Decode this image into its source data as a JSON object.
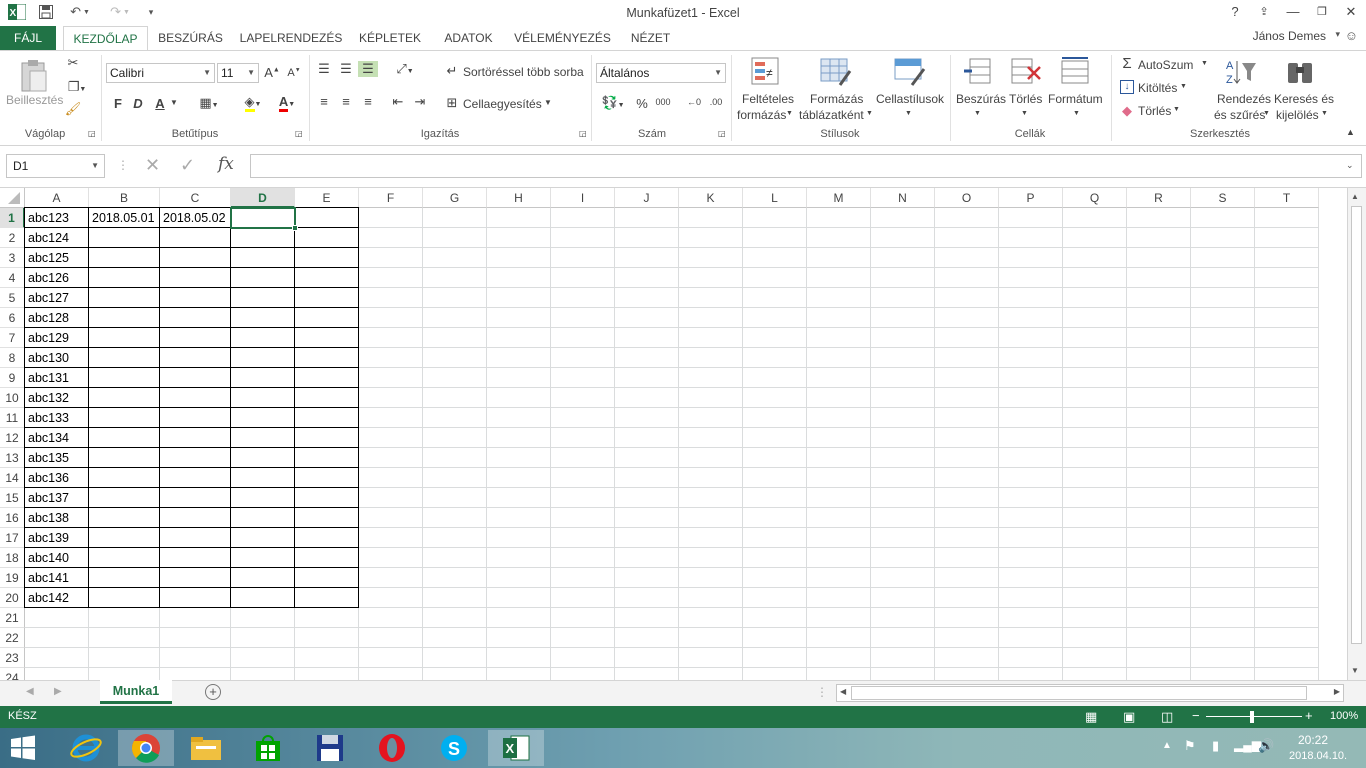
{
  "window": {
    "title": "Munkafüzet1 - Excel",
    "help": "?"
  },
  "tabs": [
    "FÁJL",
    "KEZDŐLAP",
    "BESZÚRÁS",
    "LAPELRENDEZÉS",
    "KÉPLETEK",
    "ADATOK",
    "VÉLEMÉNYEZÉS",
    "NÉZET"
  ],
  "user": "János Demes",
  "ribbon": {
    "paste": "Beillesztés",
    "font_name": "Calibri",
    "font_size": "11",
    "bold": "F",
    "italic": "D",
    "underline": "A",
    "wrap_text": "Sortöréssel több sorba",
    "merge": "Cellaegyesítés",
    "number_format": "Általános",
    "percent": "%",
    "thousands": "000",
    "cond_format": [
      "Feltételes",
      "formázás"
    ],
    "format_table": [
      "Formázás",
      "táblázatként"
    ],
    "cell_styles": "Cellastílusok",
    "insert": "Beszúrás",
    "delete": "Törlés",
    "format": "Formátum",
    "autosum": "AutoSzum",
    "fill": "Kitöltés",
    "clear": "Törlés",
    "sort": [
      "Rendezés",
      "és szűrés"
    ],
    "find": [
      "Keresés és",
      "kijelölés"
    ],
    "groups": {
      "clipboard": "Vágólap",
      "font": "Betűtípus",
      "alignment": "Igazítás",
      "number": "Szám",
      "styles": "Stílusok",
      "cells": "Cellák",
      "editing": "Szerkesztés"
    }
  },
  "formula_bar": {
    "name_box": "D1",
    "fx": "fx",
    "value": ""
  },
  "columns": [
    "A",
    "B",
    "C",
    "D",
    "E",
    "F",
    "G",
    "H",
    "I",
    "J",
    "K",
    "L",
    "M",
    "N",
    "O",
    "P",
    "Q",
    "R",
    "S",
    "T"
  ],
  "rows": [
    "1",
    "2",
    "3",
    "4",
    "5",
    "6",
    "7",
    "8",
    "9",
    "10",
    "11",
    "12",
    "13",
    "14",
    "15",
    "16",
    "17",
    "18",
    "19",
    "20",
    "21",
    "22",
    "23",
    "24"
  ],
  "cells": {
    "A": [
      "abc123",
      "abc124",
      "abc125",
      "abc126",
      "abc127",
      "abc128",
      "abc129",
      "abc130",
      "abc131",
      "abc132",
      "abc133",
      "abc134",
      "abc135",
      "abc136",
      "abc137",
      "abc138",
      "abc139",
      "abc140",
      "abc141",
      "abc142"
    ],
    "B1": "2018.05.01",
    "C1": "2018.05.02"
  },
  "sheet_tab": "Munka1",
  "status": {
    "ready": "KÉSZ",
    "zoom": "100%"
  },
  "taskbar": {
    "time": "20:22",
    "date": "2018.04.10."
  },
  "colors": {
    "excel_green": "#217346",
    "selection": "#217346"
  }
}
